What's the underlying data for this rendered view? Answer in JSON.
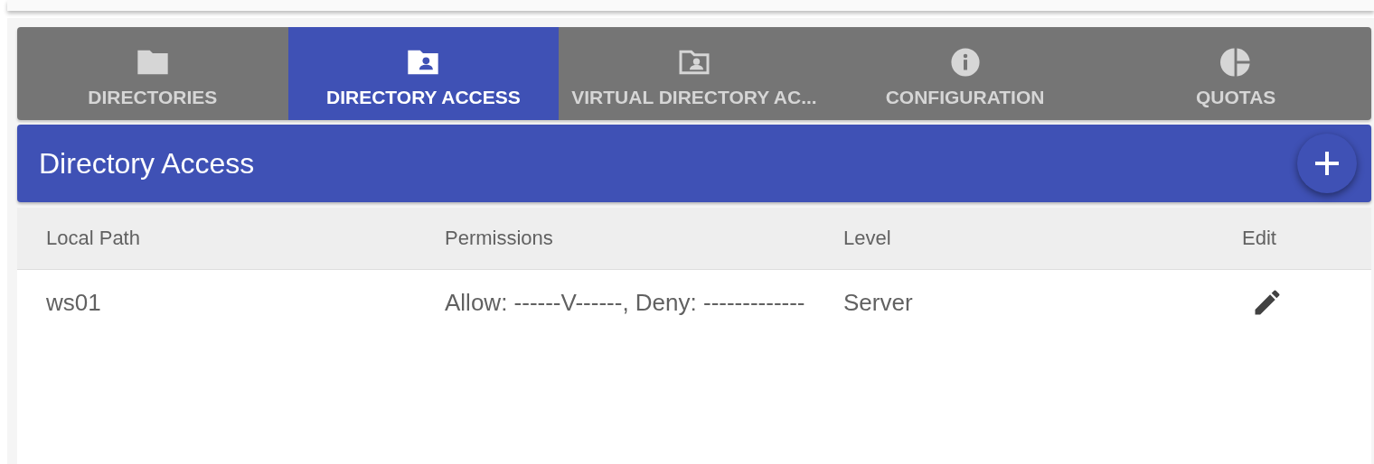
{
  "tabs": [
    {
      "label": "DIRECTORIES",
      "kind": "folder",
      "selected": false
    },
    {
      "label": "DIRECTORY ACCESS",
      "kind": "folder-user",
      "selected": true
    },
    {
      "label": "VIRTUAL DIRECTORY AC...",
      "kind": "folder-user-outline",
      "selected": false
    },
    {
      "label": "CONFIGURATION",
      "kind": "info",
      "selected": false
    },
    {
      "label": "QUOTAS",
      "kind": "pie",
      "selected": false
    }
  ],
  "header": {
    "title": "Directory Access"
  },
  "table": {
    "columns": [
      "Local Path",
      "Permissions",
      "Level",
      "Edit"
    ],
    "rows": [
      {
        "local_path": "ws01",
        "permissions": "Allow: ------V------, Deny: -------------",
        "level": "Server"
      }
    ]
  }
}
